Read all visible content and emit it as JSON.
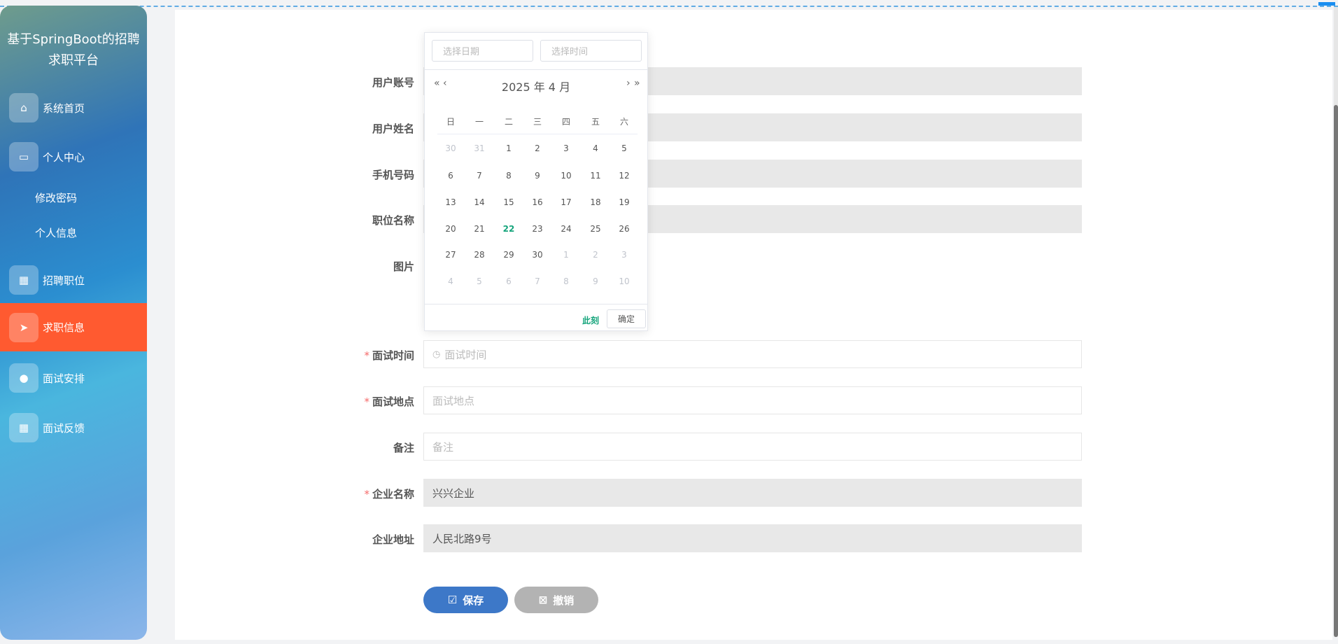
{
  "sidebar": {
    "title_line1": "基于SpringBoot的招聘",
    "title_line2": "求职平台",
    "items": [
      {
        "label": "系统首页",
        "icon": "home-icon"
      },
      {
        "label": "个人中心",
        "icon": "card-icon"
      },
      {
        "label": "招聘职位",
        "icon": "grid-icon"
      },
      {
        "label": "求职信息",
        "icon": "send-icon",
        "active": true
      },
      {
        "label": "面试安排",
        "icon": "user-icon"
      },
      {
        "label": "面试反馈",
        "icon": "grid-icon"
      }
    ],
    "subitems": [
      "修改密码",
      "个人信息"
    ]
  },
  "form": {
    "fields": [
      {
        "label": "用户账号",
        "value": ""
      },
      {
        "label": "用户姓名",
        "value": ""
      },
      {
        "label": "手机号码",
        "value": ""
      },
      {
        "label": "职位名称",
        "value": ""
      },
      {
        "label": "图片"
      },
      {
        "label": "面试时间",
        "placeholder": "面试时间",
        "required": true
      },
      {
        "label": "面试地点",
        "placeholder": "面试地点",
        "required": true
      },
      {
        "label": "备注",
        "placeholder": "备注"
      },
      {
        "label": "企业名称",
        "value": "兴兴企业",
        "required": true
      },
      {
        "label": "企业地址",
        "value": "人民北路9号"
      }
    ],
    "save": "保存",
    "cancel": "撤销",
    "required_mark": "*"
  },
  "picker": {
    "date_placeholder": "选择日期",
    "time_placeholder": "选择时间",
    "header": "2025 年  4 月",
    "prev_year": "«",
    "prev_month": "‹",
    "next_month": "›",
    "next_year": "»",
    "weekdays": [
      "日",
      "一",
      "二",
      "三",
      "四",
      "五",
      "六"
    ],
    "weeks": [
      [
        "30",
        "31",
        "1",
        "2",
        "3",
        "4",
        "5"
      ],
      [
        "6",
        "7",
        "8",
        "9",
        "10",
        "11",
        "12"
      ],
      [
        "13",
        "14",
        "15",
        "16",
        "17",
        "18",
        "19"
      ],
      [
        "20",
        "21",
        "22",
        "23",
        "24",
        "25",
        "26"
      ],
      [
        "27",
        "28",
        "29",
        "30",
        "1",
        "2",
        "3"
      ],
      [
        "4",
        "5",
        "6",
        "7",
        "8",
        "9",
        "10"
      ]
    ],
    "today": "22",
    "now": "此刻",
    "confirm": "确定"
  },
  "colors": {
    "accent": "#16a57c",
    "active_menu": "#ff5a30",
    "save": "#3d78c8",
    "cancel": "#b3b3b3"
  }
}
